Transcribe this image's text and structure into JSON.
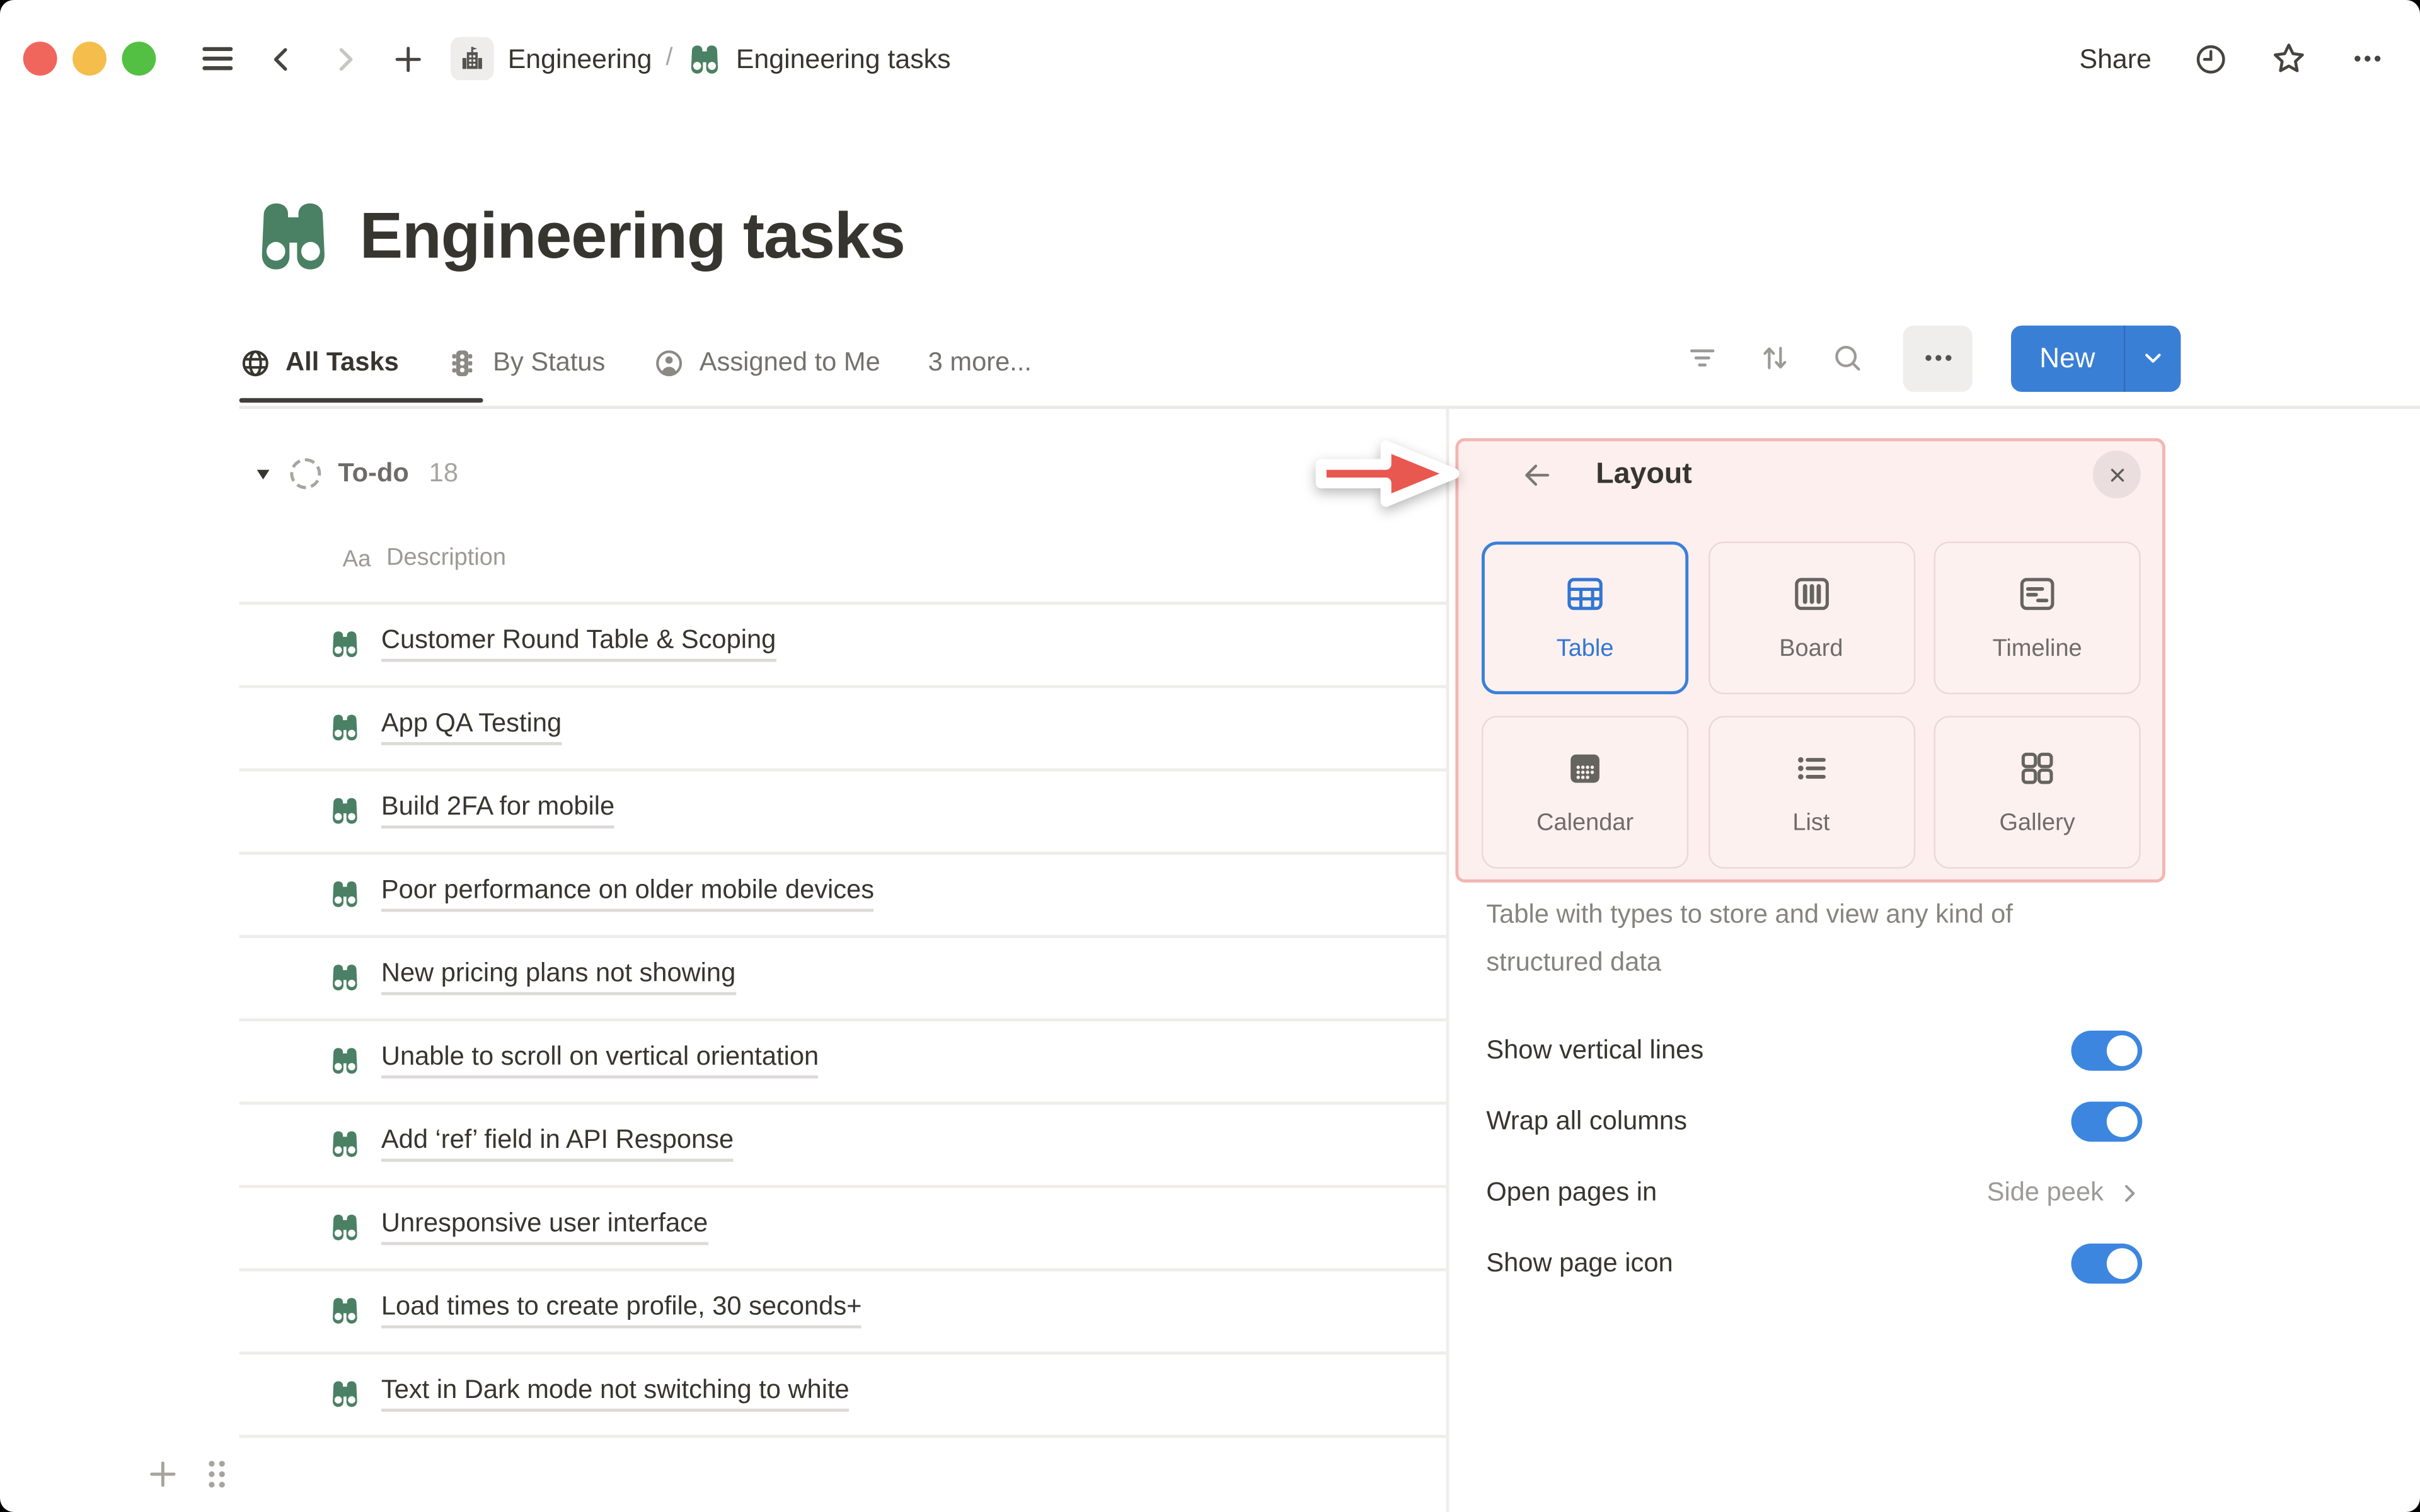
{
  "topbar": {
    "breadcrumb": {
      "workspace": "Engineering",
      "separator": "/",
      "page": "Engineering tasks"
    },
    "share_label": "Share"
  },
  "page": {
    "title": "Engineering tasks"
  },
  "tabs": {
    "items": [
      {
        "label": "All Tasks"
      },
      {
        "label": "By Status"
      },
      {
        "label": "Assigned to Me"
      },
      {
        "label": "3 more..."
      }
    ]
  },
  "toolbar": {
    "new_label": "New"
  },
  "table": {
    "group": {
      "name": "To-do",
      "count": "18"
    },
    "column_header": {
      "type_glyph": "Aa",
      "label": "Description"
    },
    "rows": [
      "Customer Round Table & Scoping",
      "App QA Testing",
      "Build 2FA for mobile",
      "Poor performance on older mobile devices",
      "New pricing plans not showing",
      "Unable to scroll on vertical orientation",
      "Add ‘ref’ field in API Response",
      "Unresponsive user interface",
      "Load times to create profile, 30 seconds+",
      "Text in Dark mode not switching to white"
    ]
  },
  "panel": {
    "title": "Layout",
    "layouts": [
      {
        "label": "Table",
        "selected": true
      },
      {
        "label": "Board",
        "selected": false
      },
      {
        "label": "Timeline",
        "selected": false
      },
      {
        "label": "Calendar",
        "selected": false
      },
      {
        "label": "List",
        "selected": false
      },
      {
        "label": "Gallery",
        "selected": false
      }
    ],
    "description": "Table with types to store and view any kind of structured data",
    "settings": [
      {
        "label": "Show vertical lines",
        "type": "toggle",
        "value": true
      },
      {
        "label": "Wrap all columns",
        "type": "toggle",
        "value": true
      },
      {
        "label": "Open pages in",
        "type": "value",
        "value": "Side peek"
      },
      {
        "label": "Show page icon",
        "type": "toggle",
        "value": true
      }
    ]
  },
  "colors": {
    "accent_blue": "#3a7fd6",
    "toggle_blue": "#3c86e0",
    "icon_green": "#4a8063",
    "highlight_bg": "#fdefee",
    "highlight_border": "#f2b6b2",
    "annotation_red": "#e85850",
    "text_dark": "#37352f",
    "text_gray": "#787774"
  }
}
